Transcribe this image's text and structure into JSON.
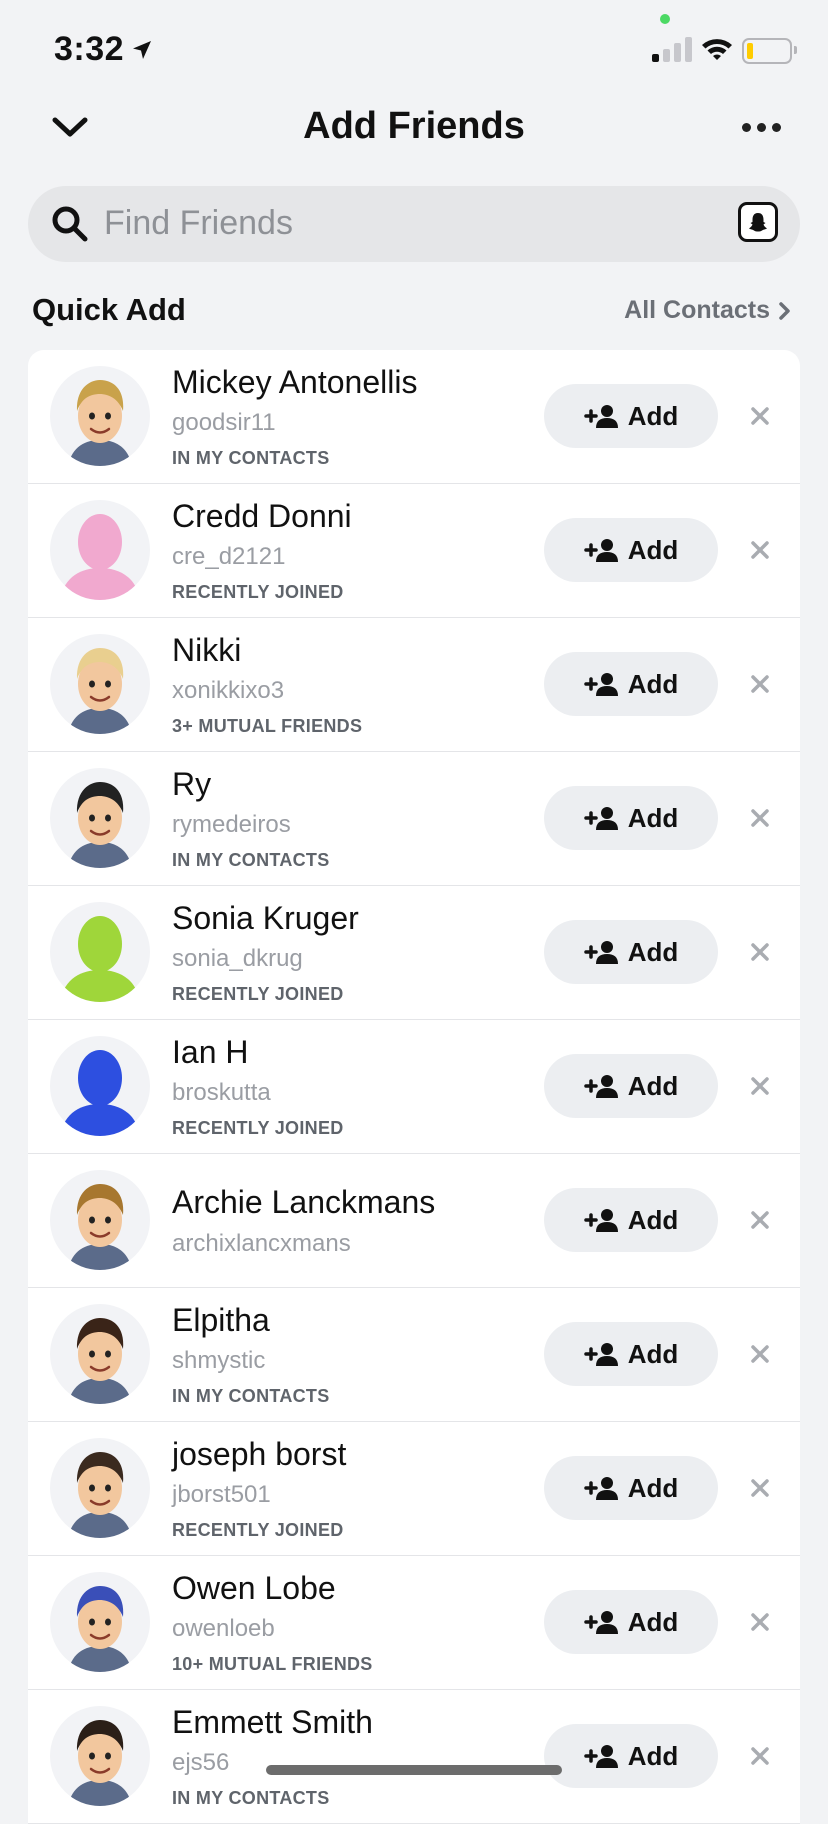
{
  "status_bar": {
    "time": "3:32",
    "battery_color": "#ffcc00"
  },
  "header": {
    "title": "Add Friends"
  },
  "search": {
    "placeholder": "Find Friends"
  },
  "quick_add": {
    "title": "Quick Add",
    "all_contacts_label": "All Contacts",
    "add_label": "Add",
    "friends": [
      {
        "name": "Mickey Antonellis",
        "username": "goodsir11",
        "reason": "IN MY CONTACTS",
        "avatar": "bitmoji-male-blond",
        "avatar_color": "#c9a24b"
      },
      {
        "name": "Credd Donni",
        "username": "cre_d2121",
        "reason": "RECENTLY JOINED",
        "avatar": "silhouette",
        "avatar_color": "#f1a9cf"
      },
      {
        "name": "Nikki",
        "username": "xonikkixo3",
        "reason": "3+ MUTUAL FRIENDS",
        "avatar": "bitmoji-female-blonde",
        "avatar_color": "#e9cf8f"
      },
      {
        "name": "Ry",
        "username": "rymedeiros",
        "reason": "IN MY CONTACTS",
        "avatar": "bitmoji-male-cap",
        "avatar_color": "#222222"
      },
      {
        "name": "Sonia Kruger",
        "username": "sonia_dkrug",
        "reason": "RECENTLY JOINED",
        "avatar": "silhouette",
        "avatar_color": "#9fd63a"
      },
      {
        "name": "Ian H",
        "username": "broskutta",
        "reason": "RECENTLY JOINED",
        "avatar": "silhouette",
        "avatar_color": "#2d4fe0"
      },
      {
        "name": "Archie Lanckmans",
        "username": "archixlancxmans",
        "reason": "",
        "avatar": "bitmoji-male-brown",
        "avatar_color": "#a7772f"
      },
      {
        "name": "Elpitha",
        "username": "shmystic",
        "reason": "IN MY CONTACTS",
        "avatar": "bitmoji-female-curly",
        "avatar_color": "#3a2418"
      },
      {
        "name": "joseph borst",
        "username": "jborst501",
        "reason": "RECENTLY JOINED",
        "avatar": "bitmoji-male-dark",
        "avatar_color": "#3b2a1f"
      },
      {
        "name": "Owen Lobe",
        "username": "owenloeb",
        "reason": "10+ MUTUAL FRIENDS",
        "avatar": "bitmoji-unicorn-hood",
        "avatar_color": "#3a4fb8"
      },
      {
        "name": "Emmett Smith",
        "username": "ejs56",
        "reason": "IN MY CONTACTS",
        "avatar": "bitmoji-male-dark",
        "avatar_color": "#2b1f18"
      }
    ]
  }
}
